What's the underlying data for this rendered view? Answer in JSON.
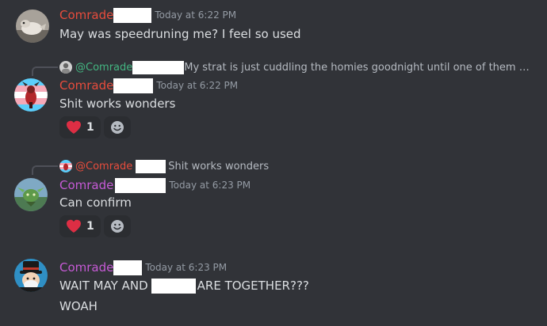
{
  "messages": [
    {
      "author": "Comrade",
      "timestamp": "Today at 6:22 PM",
      "lines": [
        "May was speedruning me? I feel so used"
      ]
    },
    {
      "reply": {
        "mention": "@Comrade",
        "preview": "My strat is just cuddling the homies goodnight until one of them asks yo..."
      },
      "author": "Comrade",
      "timestamp": "Today at 6:22 PM",
      "lines": [
        "Shit works wonders"
      ],
      "reactions": [
        {
          "emoji": "heart",
          "count": "1"
        }
      ]
    },
    {
      "reply": {
        "mention": "@Comrade",
        "preview": "Shit works wonders"
      },
      "author": "Comrade",
      "timestamp": "Today at 6:23 PM",
      "lines": [
        "Can confirm"
      ],
      "reactions": [
        {
          "emoji": "heart",
          "count": "1"
        }
      ]
    },
    {
      "author": "Comrade",
      "timestamp": "Today at 6:23 PM",
      "line1_before": "WAIT MAY AND",
      "line1_after": "ARE TOGETHER???",
      "line2": "WOAH"
    }
  ],
  "colors": {
    "background": "#313338",
    "text": "#dbdee1",
    "muted": "#949ba4",
    "author_red": "#e74c3c",
    "author_purple": "#c65ad6",
    "mention_green": "#43b581",
    "reaction_bg": "#2b2d31",
    "heart": "#dd2e44"
  }
}
